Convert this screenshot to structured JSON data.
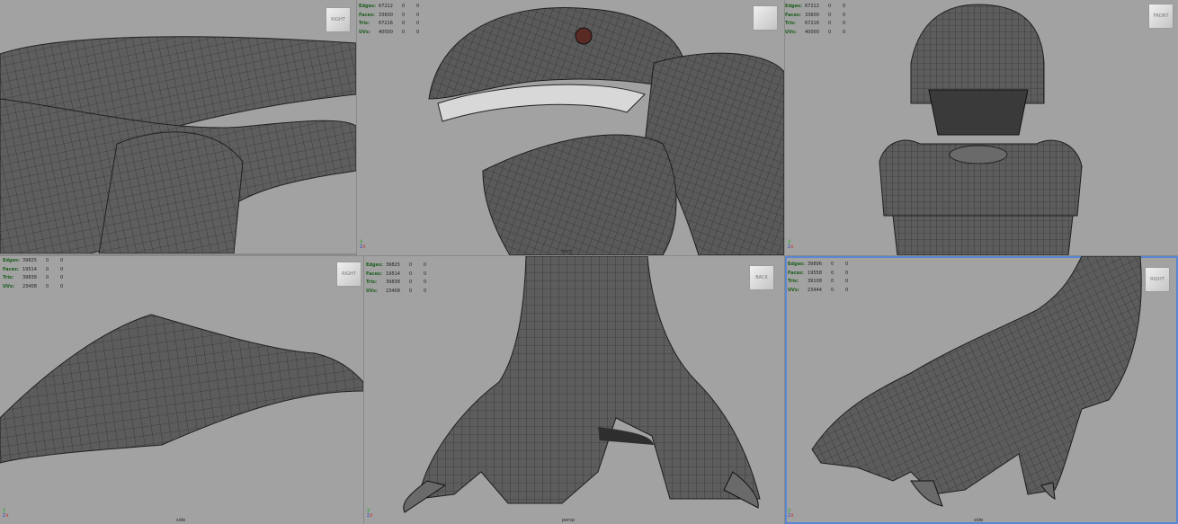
{
  "viewports": [
    {
      "camera": "",
      "cube": "RIGHT",
      "hud": []
    },
    {
      "camera": "front",
      "cube": "",
      "hud": [
        {
          "label": "Edges:",
          "v1": "67212",
          "v2": "0",
          "v3": "0"
        },
        {
          "label": "Faces:",
          "v1": "33600",
          "v2": "0",
          "v3": "0"
        },
        {
          "label": "Tris:",
          "v1": "67216",
          "v2": "0",
          "v3": "0"
        },
        {
          "label": "UVs:",
          "v1": "40000",
          "v2": "0",
          "v3": "0"
        }
      ]
    },
    {
      "camera": "",
      "cube": "FRONT",
      "hud": [
        {
          "label": "Edges:",
          "v1": "67212",
          "v2": "0",
          "v3": "0"
        },
        {
          "label": "Faces:",
          "v1": "33600",
          "v2": "0",
          "v3": "0"
        },
        {
          "label": "Tris:",
          "v1": "67216",
          "v2": "0",
          "v3": "0"
        },
        {
          "label": "UVs:",
          "v1": "40000",
          "v2": "0",
          "v3": "0"
        }
      ]
    },
    {
      "camera": "side",
      "cube": "RIGHT",
      "hud": [
        {
          "label": "Edges:",
          "v1": "39825",
          "v2": "0",
          "v3": "0"
        },
        {
          "label": "Faces:",
          "v1": "19514",
          "v2": "0",
          "v3": "0"
        },
        {
          "label": "Tris:",
          "v1": "39838",
          "v2": "0",
          "v3": "0"
        },
        {
          "label": "UVs:",
          "v1": "23408",
          "v2": "0",
          "v3": "0"
        }
      ]
    },
    {
      "camera": "persp",
      "cube": "BACK",
      "hud": [
        {
          "label": "Edges:",
          "v1": "39825",
          "v2": "0",
          "v3": "0"
        },
        {
          "label": "Faces:",
          "v1": "19514",
          "v2": "0",
          "v3": "0"
        },
        {
          "label": "Tris:",
          "v1": "39838",
          "v2": "0",
          "v3": "0"
        },
        {
          "label": "UVs:",
          "v1": "23408",
          "v2": "0",
          "v3": "0"
        }
      ]
    },
    {
      "camera": "side",
      "cube": "RIGHT",
      "hud": [
        {
          "label": "Edges:",
          "v1": "39896",
          "v2": "0",
          "v3": "0"
        },
        {
          "label": "Faces:",
          "v1": "19558",
          "v2": "0",
          "v3": "0"
        },
        {
          "label": "Tris:",
          "v1": "39108",
          "v2": "0",
          "v3": "0"
        },
        {
          "label": "UVs:",
          "v1": "23444",
          "v2": "0",
          "v3": "0"
        }
      ]
    }
  ],
  "axis": {
    "y": "y",
    "x": "x",
    "z": "z"
  },
  "colors": {
    "viewport_bg": "#a2a2a2",
    "mesh_fill": "#5b5b5b",
    "mesh_line": "#2a2a2a",
    "hud_label": "#1b5d1b",
    "active_outline": "#5a86d0"
  }
}
